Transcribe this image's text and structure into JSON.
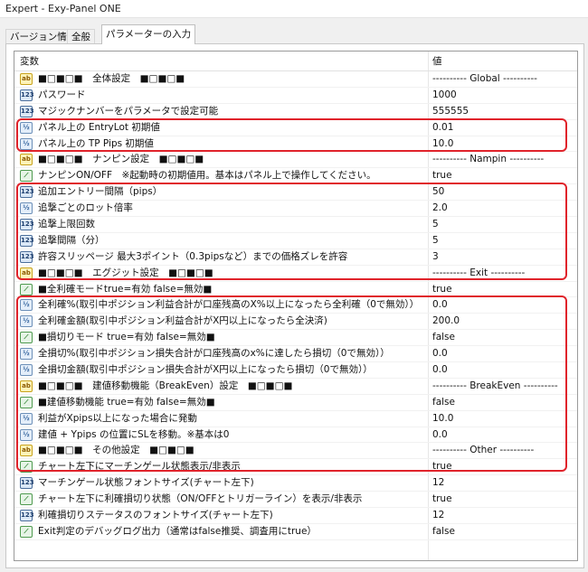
{
  "window": {
    "title": "Expert - Exy-Panel ONE"
  },
  "tabs": [
    "バージョン情報",
    "全般",
    "パラメーターの入力"
  ],
  "columns": {
    "name": "変数",
    "value": "値"
  },
  "rows": [
    {
      "icon": "ab",
      "name": "■□■□■　全体設定　■□■□■",
      "value": "---------- Global ----------"
    },
    {
      "icon": "123",
      "name": "パスワード",
      "value": "1000"
    },
    {
      "icon": "123",
      "name": "マジックナンバーをパラメータで設定可能",
      "value": "555555"
    },
    {
      "icon": "v2",
      "name": "パネル上の EntryLot 初期値",
      "value": "0.01"
    },
    {
      "icon": "v2",
      "name": "パネル上の TP Pips 初期値",
      "value": "10.0"
    },
    {
      "icon": "ab",
      "name": "■□■□■　ナンピン設定　■□■□■",
      "value": "---------- Nampin ----------"
    },
    {
      "icon": "bool",
      "name": "ナンピンON/OFF　※起動時の初期値用。基本はパネル上で操作してください。",
      "value": "true"
    },
    {
      "icon": "123",
      "name": "追加エントリー間隔（pips）",
      "value": "50"
    },
    {
      "icon": "v2",
      "name": "追撃ごとのロット倍率",
      "value": "2.0"
    },
    {
      "icon": "123",
      "name": "追撃上限回数",
      "value": "5"
    },
    {
      "icon": "123",
      "name": "追撃間隔（分）",
      "value": "5"
    },
    {
      "icon": "123",
      "name": "許容スリッページ 最大3ポイント（0.3pipsなど）までの価格ズレを許容",
      "value": "3"
    },
    {
      "icon": "ab",
      "name": "■□■□■　エグジット設定　■□■□■",
      "value": "---------- Exit ----------"
    },
    {
      "icon": "bool",
      "name": "■全利確モードtrue=有効 false=無効■",
      "value": "true"
    },
    {
      "icon": "v2",
      "name": "全利確%(取引中ポジション利益合計が口座残高のX%以上になったら全利確（0で無効））",
      "value": "0.0"
    },
    {
      "icon": "v2",
      "name": "全利確金額(取引中ポジション利益合計がX円以上になったら全決済)",
      "value": "200.0"
    },
    {
      "icon": "bool",
      "name": "■損切りモード true=有効 false=無効■",
      "value": "false"
    },
    {
      "icon": "v2",
      "name": "全損切%(取引中ポジション損失合計が口座残高のx%に達したら損切（0で無効））",
      "value": "0.0"
    },
    {
      "icon": "v2",
      "name": "全損切金額(取引中ポジション損失合計がX円以上になったら損切（0で無効））",
      "value": "0.0"
    },
    {
      "icon": "ab",
      "name": "■□■□■　建値移動機能（BreakEven）設定　■□■□■",
      "value": "---------- BreakEven ----------"
    },
    {
      "icon": "bool",
      "name": "■建値移動機能 true=有効 false=無効■",
      "value": "false"
    },
    {
      "icon": "v2",
      "name": "利益がXpips以上になった場合に発動",
      "value": "10.0"
    },
    {
      "icon": "v2",
      "name": "建値 + Ypips の位置にSLを移動。※基本は0",
      "value": "0.0"
    },
    {
      "icon": "ab",
      "name": "■□■□■　その他設定　■□■□■",
      "value": "---------- Other ----------"
    },
    {
      "icon": "bool",
      "name": "チャート左下にマーチンゲール状態表示/非表示",
      "value": "true"
    },
    {
      "icon": "123",
      "name": "マーチンゲール状態フォントサイズ(チャート左下)",
      "value": "12"
    },
    {
      "icon": "bool",
      "name": "チャート左下に利確損切り状態（ON/OFFとトリガーライン）を表示/非表示",
      "value": "true"
    },
    {
      "icon": "123",
      "name": "利確損切りステータスのフォントサイズ(チャート左下)",
      "value": "12"
    },
    {
      "icon": "bool",
      "name": "Exit判定のデバッグログ出力（通常はfalse推奨、調査用にtrue）",
      "value": "false"
    }
  ],
  "highlight_color": "#e0232b"
}
